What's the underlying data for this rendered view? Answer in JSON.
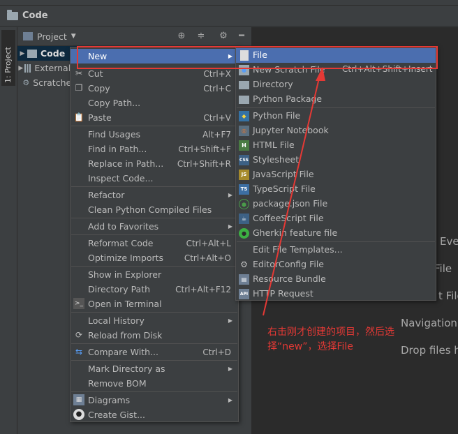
{
  "breadcrumb": {
    "title": "Code"
  },
  "tool_strip": {
    "tab_label": "1: Project"
  },
  "project_panel": {
    "title": "Project",
    "tree": [
      {
        "label": "Code"
      },
      {
        "label": "External Libraries"
      },
      {
        "label": "Scratches and Consoles"
      }
    ]
  },
  "context_menu": {
    "items": [
      {
        "label": "New",
        "shortcut": ""
      },
      {
        "label": "Cut",
        "shortcut": "Ctrl+X"
      },
      {
        "label": "Copy",
        "shortcut": "Ctrl+C"
      },
      {
        "label": "Copy Path...",
        "shortcut": ""
      },
      {
        "label": "Paste",
        "shortcut": "Ctrl+V"
      },
      {
        "label": "Find Usages",
        "shortcut": "Alt+F7"
      },
      {
        "label": "Find in Path...",
        "shortcut": "Ctrl+Shift+F"
      },
      {
        "label": "Replace in Path...",
        "shortcut": "Ctrl+Shift+R"
      },
      {
        "label": "Inspect Code...",
        "shortcut": ""
      },
      {
        "label": "Refactor",
        "shortcut": ""
      },
      {
        "label": "Clean Python Compiled Files",
        "shortcut": ""
      },
      {
        "label": "Add to Favorites",
        "shortcut": ""
      },
      {
        "label": "Reformat Code",
        "shortcut": "Ctrl+Alt+L"
      },
      {
        "label": "Optimize Imports",
        "shortcut": "Ctrl+Alt+O"
      },
      {
        "label": "Show in Explorer",
        "shortcut": ""
      },
      {
        "label": "Directory Path",
        "shortcut": "Ctrl+Alt+F12"
      },
      {
        "label": "Open in Terminal",
        "shortcut": ""
      },
      {
        "label": "Local History",
        "shortcut": ""
      },
      {
        "label": "Reload from Disk",
        "shortcut": ""
      },
      {
        "label": "Compare With...",
        "shortcut": "Ctrl+D"
      },
      {
        "label": "Mark Directory as",
        "shortcut": ""
      },
      {
        "label": "Remove BOM",
        "shortcut": ""
      },
      {
        "label": "Diagrams",
        "shortcut": ""
      },
      {
        "label": "Create Gist...",
        "shortcut": ""
      }
    ]
  },
  "new_submenu": {
    "items": [
      {
        "label": "File",
        "shortcut": ""
      },
      {
        "label": "New Scratch File",
        "shortcut": "Ctrl+Alt+Shift+Insert"
      },
      {
        "label": "Directory",
        "shortcut": ""
      },
      {
        "label": "Python Package",
        "shortcut": ""
      },
      {
        "label": "Python File",
        "shortcut": ""
      },
      {
        "label": "Jupyter Notebook",
        "shortcut": ""
      },
      {
        "label": "HTML File",
        "shortcut": ""
      },
      {
        "label": "Stylesheet",
        "shortcut": ""
      },
      {
        "label": "JavaScript File",
        "shortcut": ""
      },
      {
        "label": "TypeScript File",
        "shortcut": ""
      },
      {
        "label": "package.json File",
        "shortcut": ""
      },
      {
        "label": "CoffeeScript File",
        "shortcut": ""
      },
      {
        "label": "Gherkin feature file",
        "shortcut": ""
      },
      {
        "label": "Edit File Templates...",
        "shortcut": ""
      },
      {
        "label": "EditorConfig File",
        "shortcut": ""
      },
      {
        "label": "Resource Bundle",
        "shortcut": ""
      },
      {
        "label": "HTTP Request",
        "shortcut": ""
      }
    ],
    "icon_text": {
      "html": "H",
      "css": "CSS",
      "js": "JS",
      "ts": "TS",
      "api": "API"
    }
  },
  "editor_hints": [
    "Eve",
    "File",
    "t File",
    "Navigation",
    "Drop files h"
  ],
  "annotation": {
    "line1": "右击刚才创建的项目，然后选",
    "line2": "择“new”，选择File"
  },
  "colors": {
    "highlight": "#4b6eaf",
    "annotation_red": "#e53935",
    "menu_bg": "#3c3f41",
    "editor_bg": "#2b2b2b"
  }
}
